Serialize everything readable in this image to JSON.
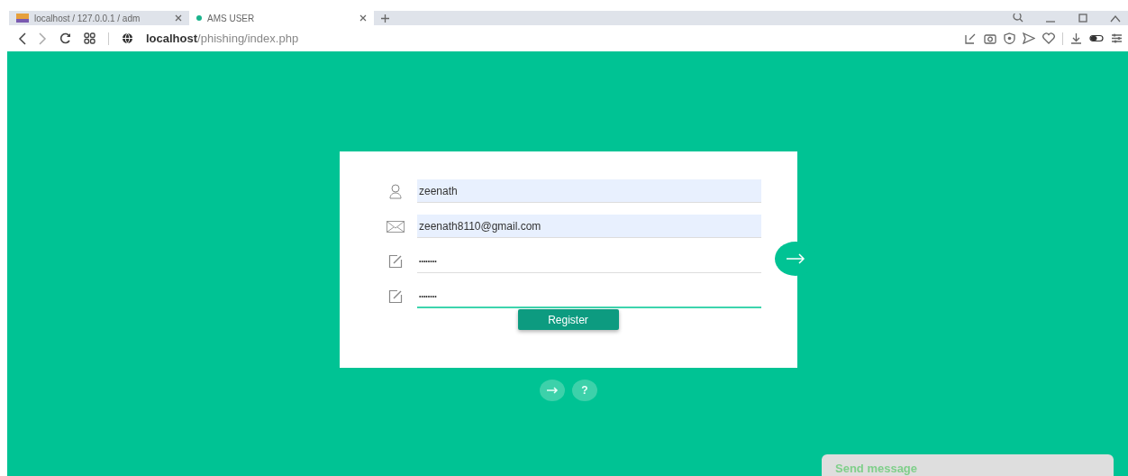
{
  "tabs": [
    {
      "label": "localhost / 127.0.0.1 / adm",
      "selected": false
    },
    {
      "label": "AMS USER",
      "selected": true
    }
  ],
  "address": {
    "host": "localhost",
    "path": "/phishing/index.php"
  },
  "form": {
    "fields": [
      {
        "kind": "user",
        "value": "zeenath",
        "autofilled": true,
        "focused": false
      },
      {
        "kind": "mail",
        "value": "zeenath8110@gmail.com",
        "autofilled": true,
        "focused": false
      },
      {
        "kind": "password",
        "value": "••••••••",
        "autofilled": false,
        "focused": false
      },
      {
        "kind": "password",
        "value": "••••••••",
        "autofilled": false,
        "focused": true
      }
    ],
    "submit": "Register"
  },
  "help_button": "?",
  "chat": {
    "placeholder": "Send message"
  }
}
